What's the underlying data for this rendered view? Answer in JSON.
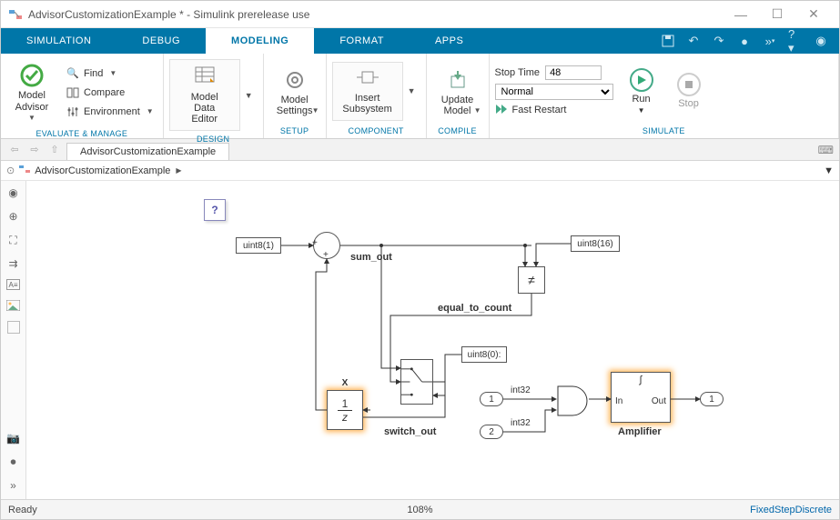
{
  "window": {
    "title": "AdvisorCustomizationExample * - Simulink prerelease use"
  },
  "tabs": {
    "items": [
      "SIMULATION",
      "DEBUG",
      "MODELING",
      "FORMAT",
      "APPS"
    ],
    "active": 2
  },
  "ribbon": {
    "evaluate": {
      "label": "EVALUATE & MANAGE",
      "model_advisor": "Model\nAdvisor",
      "find": "Find",
      "compare": "Compare",
      "environment": "Environment"
    },
    "design": {
      "label": "DESIGN",
      "model_data_editor": "Model Data\nEditor"
    },
    "setup": {
      "label": "SETUP",
      "model_settings": "Model\nSettings"
    },
    "component": {
      "label": "COMPONENT",
      "insert_subsystem": "Insert\nSubsystem"
    },
    "compile": {
      "label": "COMPILE",
      "update_model": "Update\nModel"
    },
    "simulate": {
      "label": "SIMULATE",
      "stop_time_label": "Stop Time",
      "stop_time_value": "48",
      "mode": "Normal",
      "fast_restart": "Fast Restart",
      "run": "Run",
      "stop": "Stop"
    }
  },
  "breadcrumb": {
    "tab": "AdvisorCustomizationExample",
    "path": "AdvisorCustomizationExample"
  },
  "model": {
    "const1": "uint8(1)",
    "const2": "uint8(16)",
    "const3": "uint8(0):",
    "sum_out": "sum_out",
    "equal_to_count": "equal_to_count",
    "switch_out": "switch_out",
    "neq": "≠",
    "delay_x": "X",
    "delay_frac_num": "1",
    "delay_frac_den": "z",
    "amplifier": "Amplifier",
    "amp_in": "In",
    "amp_out": "Out",
    "in1": "1",
    "in2": "2",
    "out1": "1",
    "int32_a": "int32",
    "int32_b": "int32",
    "help": "?"
  },
  "status": {
    "ready": "Ready",
    "zoom": "108%",
    "solver": "FixedStepDiscrete"
  }
}
